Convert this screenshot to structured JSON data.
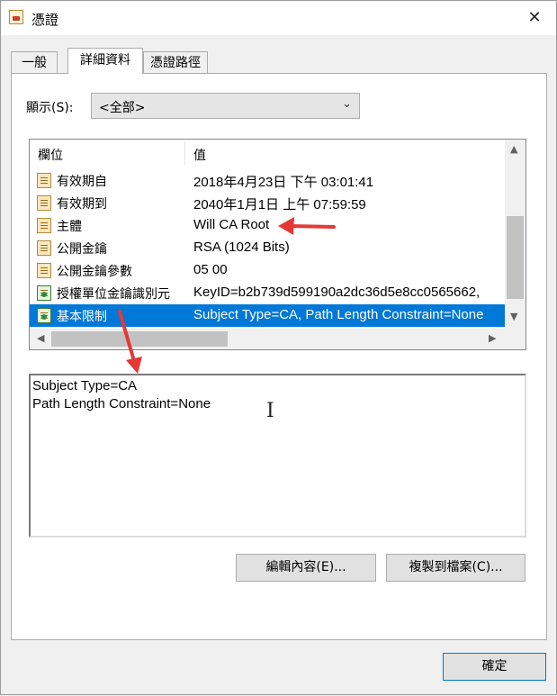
{
  "window": {
    "title": "憑證",
    "close_glyph": "✕"
  },
  "tabs": [
    {
      "label": "一般"
    },
    {
      "label": "詳細資料",
      "active": true
    },
    {
      "label": "憑證路徑"
    }
  ],
  "show": {
    "label": "顯示(S):",
    "selected": "<全部>"
  },
  "list": {
    "header": {
      "field": "欄位",
      "value": "值"
    },
    "rows": [
      {
        "field": "有效期自",
        "value": "2018年4月23日 下午 03:01:41",
        "icon": "certificate-field-icon"
      },
      {
        "field": "有效期到",
        "value": "2040年1月1日 上午 07:59:59",
        "icon": "certificate-field-icon"
      },
      {
        "field": "主體",
        "value": "Will CA Root",
        "icon": "certificate-field-icon"
      },
      {
        "field": "公開金鑰",
        "value": "RSA (1024 Bits)",
        "icon": "certificate-field-icon"
      },
      {
        "field": "公開金鑰參數",
        "value": "05 00",
        "icon": "certificate-field-icon"
      },
      {
        "field": "授權單位金鑰識別元",
        "value": "KeyID=b2b739d599190a2dc36d5e8cc0565662,",
        "icon": "certificate-extension-icon"
      },
      {
        "field": "基本限制",
        "value": "Subject Type=CA, Path Length Constraint=None",
        "icon": "certificate-extension-icon",
        "selected": true
      }
    ]
  },
  "detail": {
    "lines": [
      "Subject Type=CA",
      "Path Length Constraint=None"
    ]
  },
  "buttons": {
    "edit_properties": "編輯內容(E)...",
    "copy_to_file": "複製到檔案(C)...",
    "ok": "確定"
  },
  "annotation_color": "#e53935"
}
